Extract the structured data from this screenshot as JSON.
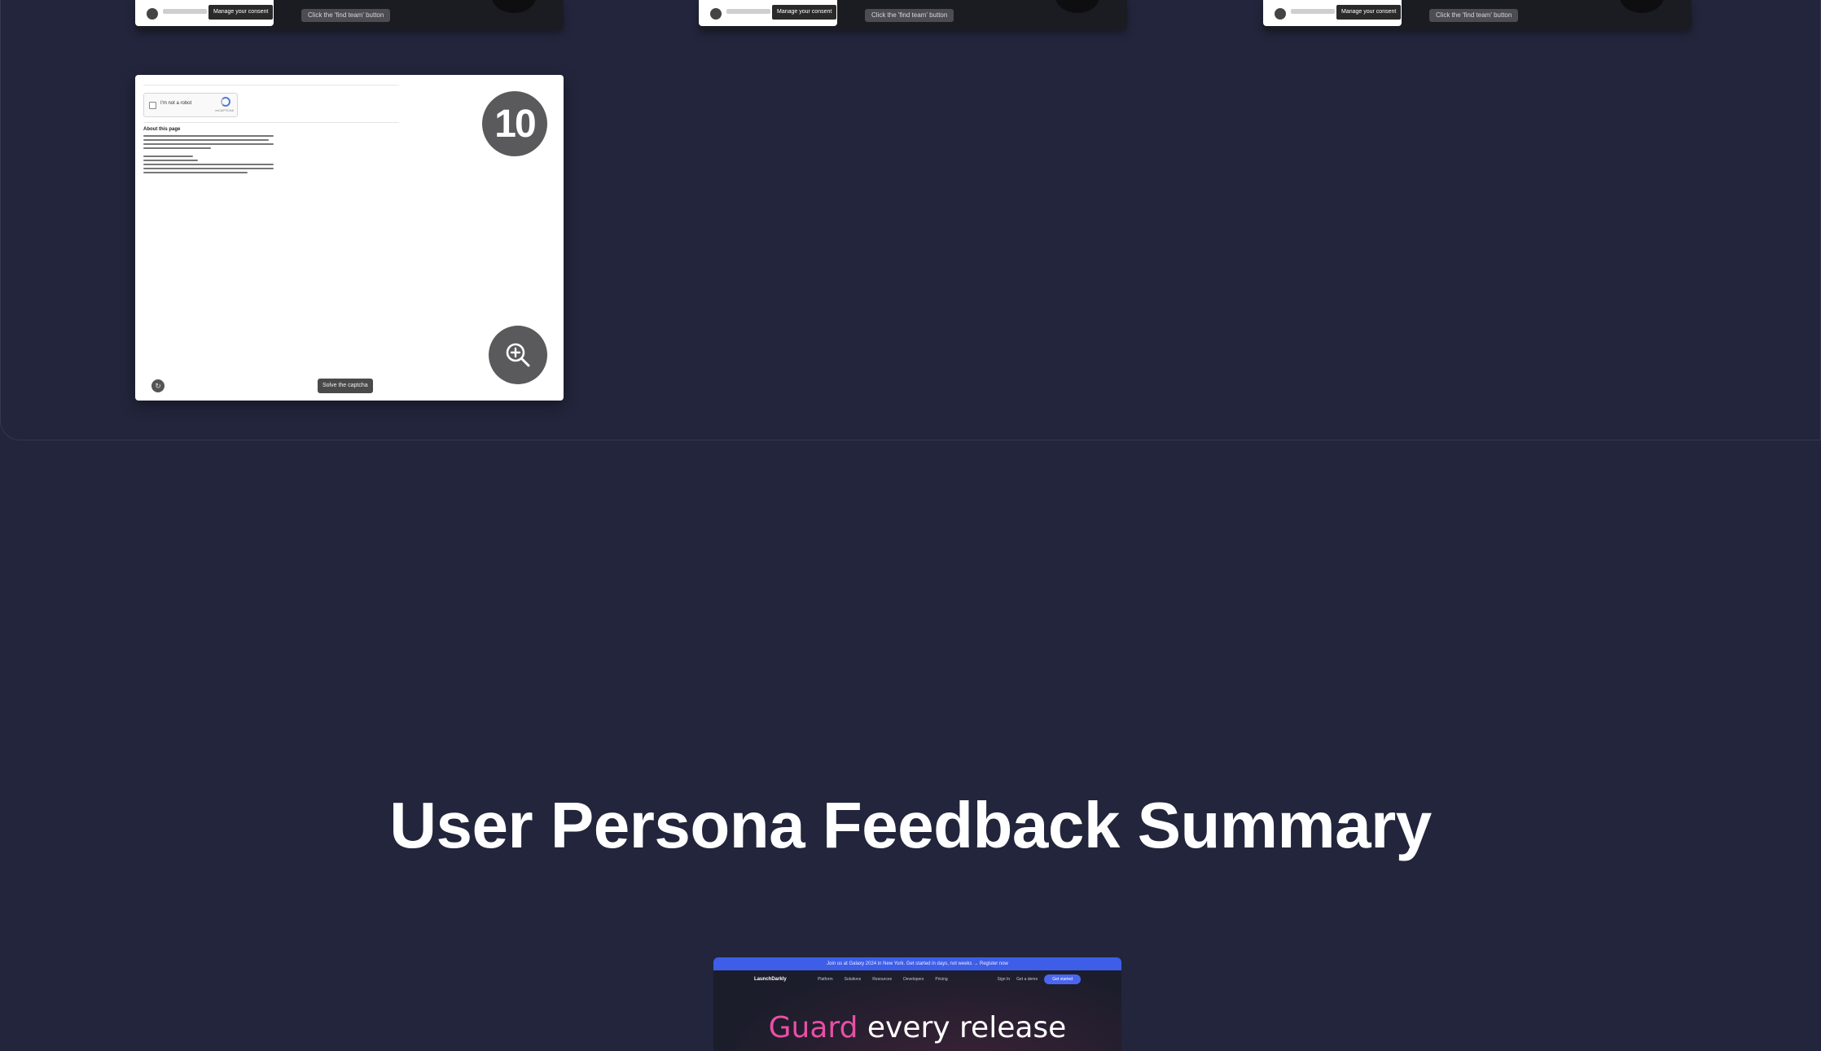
{
  "top_row": [
    {
      "button_label": "Manage your consent",
      "caption": "Click the 'find team' button"
    },
    {
      "button_label": "Manage your consent",
      "caption": "Click the 'find team' button"
    },
    {
      "button_label": "Manage your consent",
      "caption": "Click the 'find team' button"
    }
  ],
  "card10": {
    "number": "10",
    "recaptcha_label": "I'm not a robot",
    "recaptcha_brand": "reCAPTCHA",
    "about_title": "About this page",
    "bottom_caption": "Solve the captcha",
    "refresh_glyph": "↻"
  },
  "section": {
    "title": "User Persona Feedback Summary"
  },
  "preview": {
    "banner": "Join us at Galaxy 2024 in New York. Get started in days, not weeks → Register now",
    "brand": "LaunchDarkly",
    "nav_links": [
      "Platform",
      "Solutions",
      "Resources",
      "Developers",
      "Pricing"
    ],
    "sign_in": "Sign In",
    "contact": "Get a demo",
    "cta": "Get started",
    "hero_accent": "Guard",
    "hero_rest": " every release"
  },
  "colors": {
    "background": "#22253b",
    "badge": "#5a5a5c",
    "banner": "#3e5ee8",
    "hero_accent": "#e94fa5"
  }
}
